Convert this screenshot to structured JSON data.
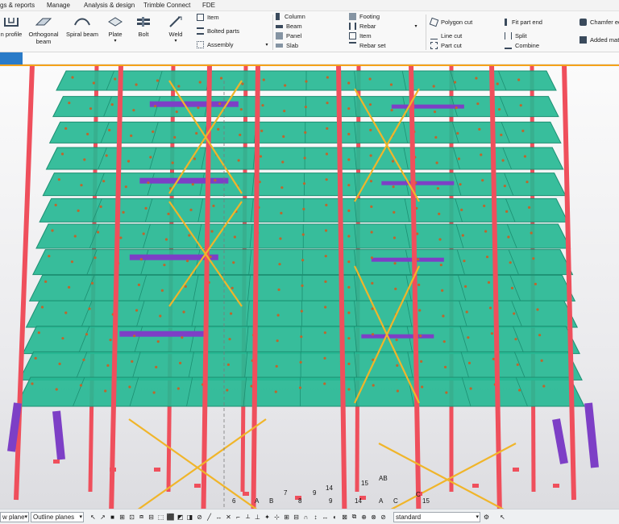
{
  "menu": {
    "items": [
      "gs & reports",
      "Manage",
      "Analysis & design",
      "Trimble Connect",
      "FDE"
    ]
  },
  "ribbon": {
    "large_buttons": [
      {
        "label": "n profile",
        "icon": "profile-icon"
      },
      {
        "label": "Orthogonal beam",
        "icon": "orthogonal-beam-icon"
      },
      {
        "label": "Spiral beam",
        "icon": "spiral-beam-icon"
      },
      {
        "label": "Plate",
        "icon": "plate-icon"
      },
      {
        "label": "Bolt",
        "icon": "bolt-icon"
      },
      {
        "label": "Weld",
        "icon": "weld-icon"
      }
    ],
    "group_assembly": [
      "Item",
      "Bolted parts",
      "Assembly"
    ],
    "group_concrete_left": [
      "Column",
      "Beam",
      "Panel",
      "Slab"
    ],
    "group_concrete_right": [
      "Footing",
      "Rebar",
      "Item",
      "Rebar set"
    ],
    "group_cuts": [
      "Polygon cut",
      "Line cut",
      "Part cut"
    ],
    "group_fit": [
      "Fit part end",
      "Split",
      "Combine"
    ],
    "group_edit": [
      "Chamfer edg",
      "Added mate"
    ]
  },
  "statusbar": {
    "view_plane": "w plane",
    "outline_planes": "Outline planes",
    "standard": "standard"
  },
  "viewport": {
    "grid_labels": [
      "6",
      "A",
      "B",
      "7",
      "8",
      "9",
      "9",
      "14",
      "15",
      "AB",
      "C",
      "15",
      "A",
      "14",
      "C"
    ]
  },
  "colors": {
    "floor": "#27b894",
    "floor_dark": "#1c8f72",
    "column": "#ef4f5c",
    "brace": "#f0b52a",
    "purple": "#7d3fc6",
    "bolt": "#c0652c",
    "accent": "#f4a21a",
    "tab": "#2a7bc8"
  }
}
